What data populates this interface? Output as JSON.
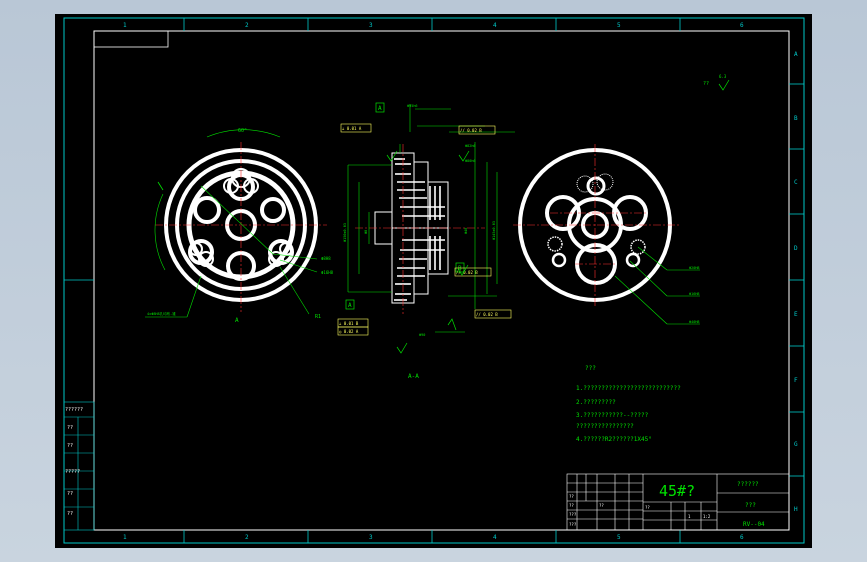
{
  "frame": {
    "zones_top": [
      "1",
      "2",
      "3",
      "4",
      "5",
      "6"
    ],
    "zones_bottom": [
      "1",
      "2",
      "3",
      "4",
      "5",
      "6"
    ],
    "zones_right": [
      "A",
      "B",
      "C",
      "D",
      "E",
      "F",
      "G",
      "H"
    ]
  },
  "views": {
    "section_label": "A-A",
    "cut_marker": "A",
    "angle": "60°"
  },
  "callouts": {
    "left": [
      "Φ8H8",
      "Φ16H8",
      "Φ90",
      "R1"
    ],
    "left_bottom": "4xΦ8H8孔均布-锥",
    "right": [
      "Φ20H8",
      "Φ16H8",
      "Φ40H8"
    ],
    "mid_top": [
      "Φ95h6",
      "Φ82h6",
      "Φ80h6"
    ],
    "mid_side": [
      "Φ150±0.03",
      "Φ8",
      "Φ48",
      "Φ145±0.03"
    ],
    "datum_tags": [
      "A",
      "A",
      "B"
    ],
    "tolerance_frames": [
      "⊥ 0.01 A",
      "// 0.02 B",
      "// 0.02 B",
      "// 0.02 B",
      "⊥ 0.01 B",
      "◎ 0.02 A"
    ]
  },
  "roughness": "?? ",
  "roughness_value": "6.3",
  "notes": {
    "title": "???",
    "items": [
      "1.???????????????????????????",
      "2.?????????",
      "3.???????????--?????",
      "  ????????????????",
      "4.??????R2??????1X45°"
    ]
  },
  "title_block": {
    "material": "45#?",
    "company": "??????",
    "part_name": "???",
    "drawing_no": "RV--04",
    "scale": "1:2",
    "small_cells": [
      "??",
      "??",
      "???",
      "???",
      "??",
      "??",
      "1",
      "1:2"
    ]
  },
  "left_strip": [
    "??????",
    "??",
    "??",
    "?????",
    "??",
    "??"
  ]
}
